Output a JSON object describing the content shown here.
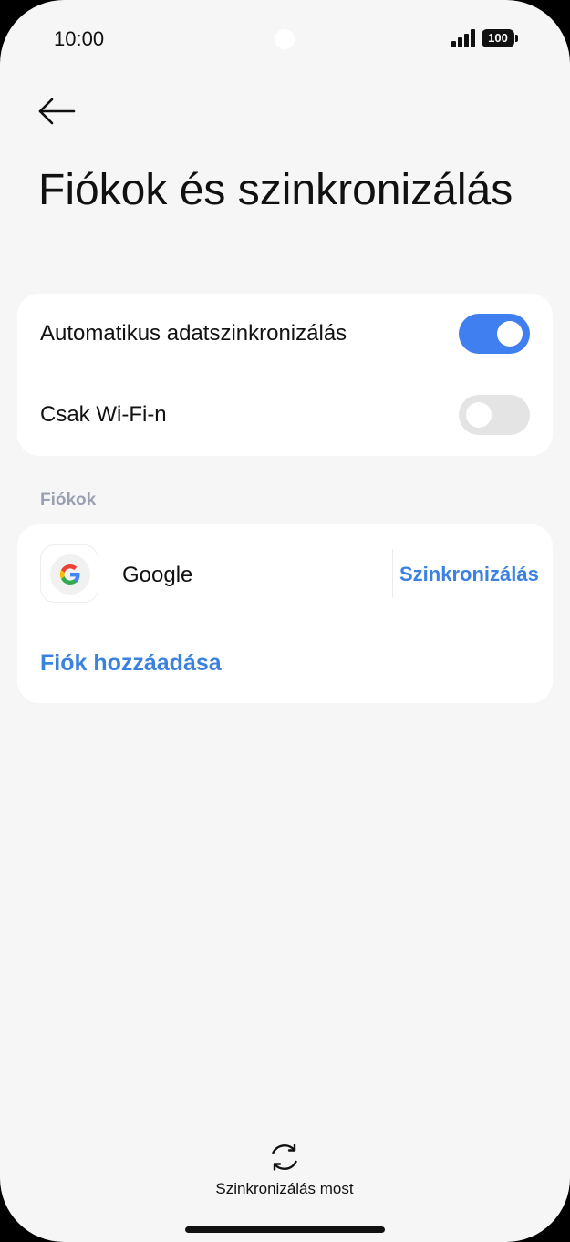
{
  "status_bar": {
    "time": "10:00",
    "battery": "100",
    "signal_icon": "signal-bars-icon"
  },
  "header": {
    "back_icon": "arrow-left-icon",
    "title": "Fiókok és szinkronizálás"
  },
  "sync_settings": {
    "auto_sync": {
      "label": "Automatikus adatszinkronizálás",
      "enabled": true
    },
    "wifi_only": {
      "label": "Csak Wi-Fi-n",
      "enabled": false
    }
  },
  "accounts_section": {
    "header": "Fiókok",
    "accounts": [
      {
        "name": "Google",
        "icon": "google-logo-icon",
        "action_label": "Szinkronizálás"
      }
    ],
    "add_account_label": "Fiók hozzáadása"
  },
  "footer": {
    "sync_now_icon": "sync-icon",
    "sync_now_label": "Szinkronizálás most"
  },
  "colors": {
    "accent": "#3f7ff0",
    "link": "#3b82e0",
    "background": "#f6f6f6",
    "card": "#ffffff",
    "section_header": "#9aa0b1"
  }
}
